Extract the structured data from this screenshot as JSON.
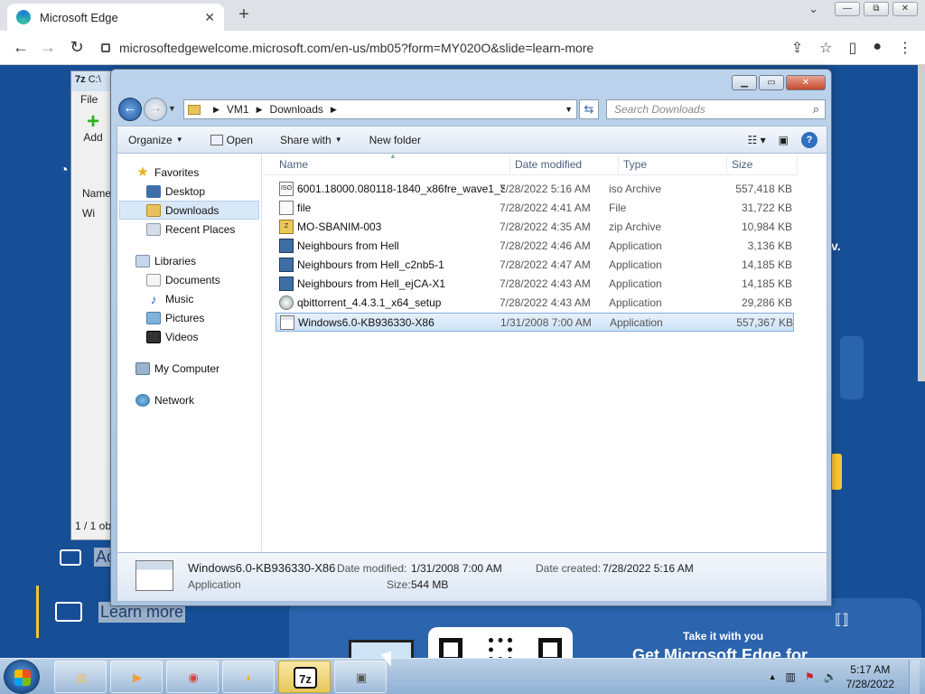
{
  "browser": {
    "tab_title": "Microsoft Edge",
    "tab_close": "✕",
    "new_tab": "+",
    "url": "microsoftedgewelcome.microsoft.com/en-us/mb05?form=MY020O&slide=learn-more",
    "tab_menu_chevron": "⌄",
    "vm_buttons": [
      "—",
      "⧉",
      "✕"
    ],
    "nav": {
      "back": "←",
      "forward": "→",
      "refresh": "↻"
    },
    "toolbar_right": [
      "⇪",
      "☆",
      "▯",
      "●",
      "⋮"
    ]
  },
  "edge_page": {
    "learn_more": "Learn more",
    "partial_text": "Ad",
    "partial_right": "v.",
    "take_it_with_you": "Take it with you",
    "get_edge": "Get Microsoft Edge for"
  },
  "sevenzip": {
    "title": "C:\\",
    "menu_file": "File",
    "add_label": "Add",
    "col_name": "Name",
    "item": "Wi",
    "status": "1 / 1 ob"
  },
  "explorer": {
    "breadcrumb": [
      "VM1",
      "Downloads"
    ],
    "search_placeholder": "Search Downloads",
    "commands": {
      "organize": "Organize",
      "open": "Open",
      "share_with": "Share with",
      "new_folder": "New folder"
    },
    "nav_groups": [
      {
        "label": "Favorites",
        "icon": "star-icon",
        "children": [
          {
            "label": "Desktop",
            "icon": "desktop-icon"
          },
          {
            "label": "Downloads",
            "icon": "downloads-folder-icon",
            "selected": true
          },
          {
            "label": "Recent Places",
            "icon": "recent-places-icon"
          }
        ]
      },
      {
        "label": "Libraries",
        "icon": "libraries-icon",
        "children": [
          {
            "label": "Documents",
            "icon": "documents-icon"
          },
          {
            "label": "Music",
            "icon": "music-icon"
          },
          {
            "label": "Pictures",
            "icon": "pictures-icon"
          },
          {
            "label": "Videos",
            "icon": "videos-icon"
          }
        ]
      },
      {
        "label": "My Computer",
        "icon": "computer-icon",
        "children": []
      },
      {
        "label": "Network",
        "icon": "network-icon",
        "children": []
      }
    ],
    "columns": {
      "name": "Name",
      "date": "Date modified",
      "type": "Type",
      "size": "Size"
    },
    "files": [
      {
        "name": "6001.18000.080118-1840_x86fre_wave1_Se...",
        "date": "7/28/2022 5:16 AM",
        "type": "iso Archive",
        "size": "557,418 KB",
        "icon": "iso-icon",
        "icon_text": "ISO"
      },
      {
        "name": "file",
        "date": "7/28/2022 4:41 AM",
        "type": "File",
        "size": "31,722 KB",
        "icon": "file-icon",
        "icon_text": ""
      },
      {
        "name": "MO-SBANIM-003",
        "date": "7/28/2022 4:35 AM",
        "type": "zip Archive",
        "size": "10,984 KB",
        "icon": "zip-icon",
        "icon_text": "Z"
      },
      {
        "name": "Neighbours from Hell",
        "date": "7/28/2022 4:46 AM",
        "type": "Application",
        "size": "3,136 KB",
        "icon": "game-app-icon",
        "icon_text": ""
      },
      {
        "name": "Neighbours from Hell_c2nb5-1",
        "date": "7/28/2022 4:47 AM",
        "type": "Application",
        "size": "14,185 KB",
        "icon": "game-app-icon",
        "icon_text": ""
      },
      {
        "name": "Neighbours from Hell_ejCA-X1",
        "date": "7/28/2022 4:43 AM",
        "type": "Application",
        "size": "14,185 KB",
        "icon": "game-app-icon",
        "icon_text": ""
      },
      {
        "name": "qbittorrent_4.4.3.1_x64_setup",
        "date": "7/28/2022 4:43 AM",
        "type": "Application",
        "size": "29,286 KB",
        "icon": "installer-icon",
        "icon_text": ""
      },
      {
        "name": "Windows6.0-KB936330-X86",
        "date": "1/31/2008 7:00 AM",
        "type": "Application",
        "size": "557,367 KB",
        "icon": "application-icon",
        "icon_text": "",
        "selected": true
      }
    ],
    "details": {
      "name": "Windows6.0-KB936330-X86",
      "kind": "Application",
      "date_modified_label": "Date modified:",
      "date_modified": "1/31/2008 7:00 AM",
      "date_created_label": "Date created:",
      "date_created": "7/28/2022 5:16 AM",
      "size_label": "Size:",
      "size": "544 MB"
    }
  },
  "taskbar": {
    "apps": [
      {
        "name": "explorer-taskbar-button",
        "glyph": "▤",
        "color": "#e8c35a"
      },
      {
        "name": "media-player-taskbar-button",
        "glyph": "▶",
        "color": "#f39c34"
      },
      {
        "name": "chrome-taskbar-button",
        "glyph": "◉",
        "color": "#db4437"
      },
      {
        "name": "chrome-alt-taskbar-button",
        "glyph": "◐",
        "color": "#f4b400"
      },
      {
        "name": "sevenzip-taskbar-button",
        "glyph": "7z",
        "color": "#111111",
        "active": true
      },
      {
        "name": "installer-taskbar-button",
        "glyph": "▣",
        "color": "#555555"
      }
    ],
    "tray_icons": [
      "▲",
      "▥",
      "⚑",
      "🔈"
    ],
    "time": "5:17 AM",
    "date": "7/28/2022"
  }
}
